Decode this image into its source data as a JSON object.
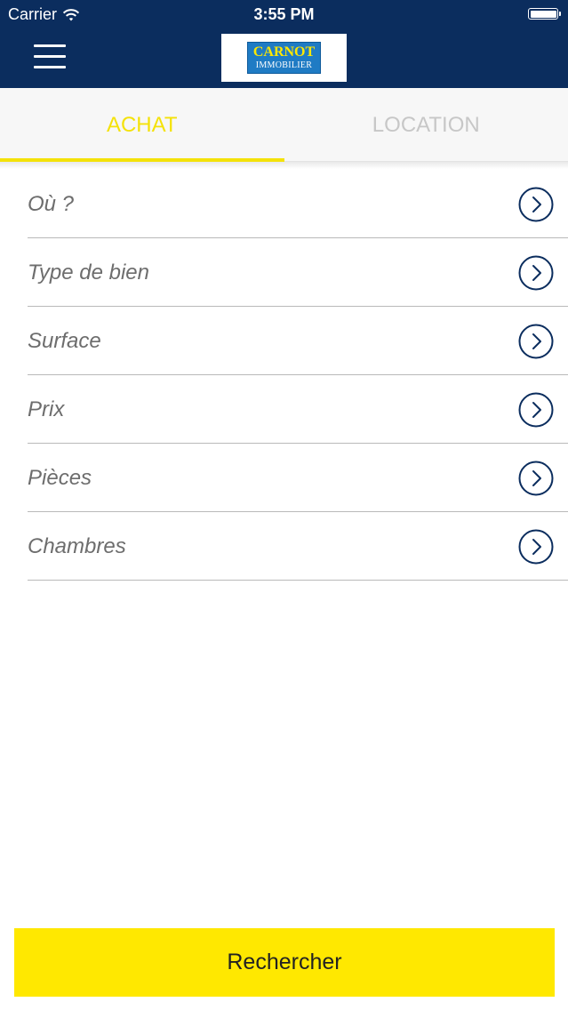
{
  "status_bar": {
    "carrier": "Carrier",
    "time": "3:55 PM",
    "wifi_icon": "wifi-icon",
    "battery_icon": "battery-icon"
  },
  "header": {
    "menu_icon": "hamburger-menu-icon",
    "logo": {
      "line1": "CARNOT",
      "line2": "IMMOBILIER"
    },
    "colors": {
      "background": "#0b2d5e",
      "logo_blue": "#1f7bc4",
      "logo_yellow": "#ffe800"
    }
  },
  "tabs": [
    {
      "label": "ACHAT",
      "active": true
    },
    {
      "label": "LOCATION",
      "active": false
    }
  ],
  "criteria": [
    {
      "label": "Où ?",
      "icon": "chevron-right-circle-icon"
    },
    {
      "label": "Type de bien",
      "icon": "chevron-right-circle-icon"
    },
    {
      "label": "Surface",
      "icon": "chevron-right-circle-icon"
    },
    {
      "label": "Prix",
      "icon": "chevron-right-circle-icon"
    },
    {
      "label": "Pièces",
      "icon": "chevron-right-circle-icon"
    },
    {
      "label": "Chambres",
      "icon": "chevron-right-circle-icon"
    }
  ],
  "search_button": {
    "label": "Rechercher"
  },
  "colors": {
    "accent": "#f4e209",
    "button": "#ffe800",
    "inactive_tab": "#c7c7c7",
    "chevron": "#0b2d5e"
  }
}
